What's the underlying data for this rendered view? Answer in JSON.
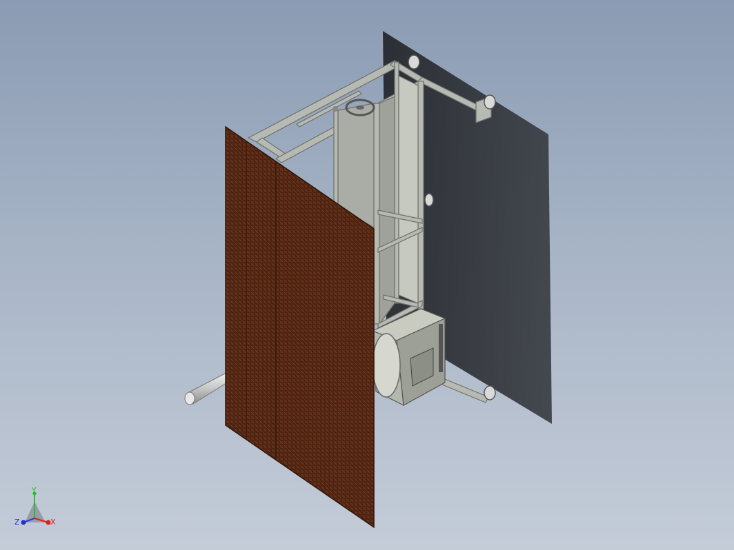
{
  "viewport": {
    "background_top": "#8a9bb3",
    "background_bottom": "#c4ccd8"
  },
  "model": {
    "name_icon": "cad-assembly-isometric",
    "frame_color": "#b9bcb3",
    "panel_color": "#5a2a16",
    "shadow_color": "#2a2c30"
  },
  "triad": {
    "x_label": "X",
    "y_label": "Y",
    "z_label": "Z",
    "x_color": "#e02020",
    "y_color": "#20c020",
    "z_color": "#2030e0"
  }
}
